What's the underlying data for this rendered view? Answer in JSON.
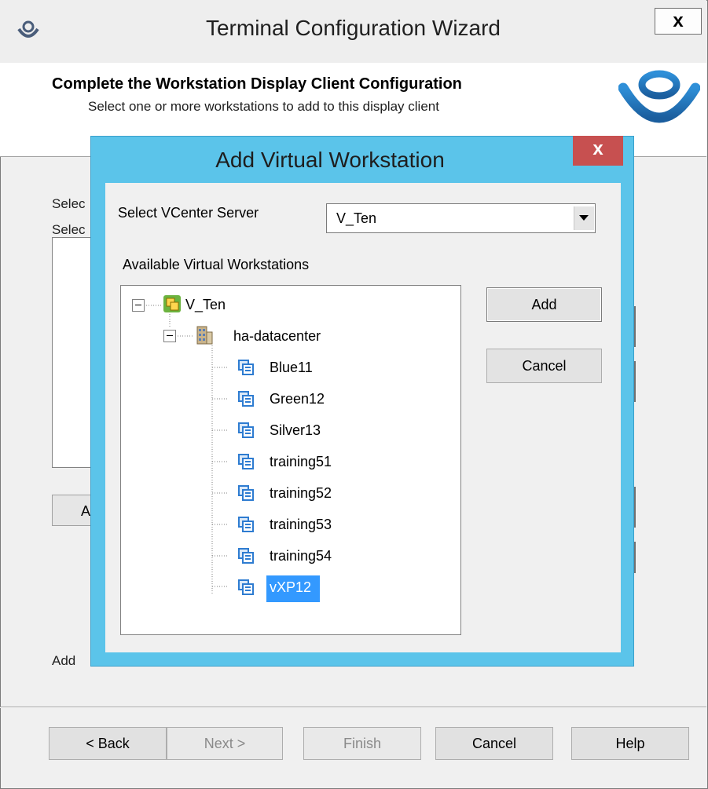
{
  "wizard": {
    "title": "Terminal Configuration Wizard",
    "close_label": "x",
    "header_title": "Complete the Workstation Display Client Configuration",
    "header_subtitle": "Select one or more workstations to add to this display client",
    "body_label_1": "Selec",
    "body_label_2": "Selec",
    "body_button_partial": "A",
    "body_bottom_label": "Add"
  },
  "footer_buttons": {
    "back": "< Back",
    "next": "Next >",
    "finish": "Finish",
    "cancel": "Cancel",
    "help": "Help"
  },
  "dialog": {
    "title": "Add Virtual Workstation",
    "close_label": "x",
    "server_label": "Select VCenter Server",
    "server_value": "V_Ten",
    "available_label": "Available Virtual Workstations",
    "add_button": "Add",
    "cancel_button": "Cancel"
  },
  "tree": {
    "root": "V_Ten",
    "datacenter": "ha-datacenter",
    "vms": [
      "Blue11",
      "Green12",
      "Silver13",
      "training51",
      "training52",
      "training53",
      "training54",
      "vXP12"
    ],
    "selected": "vXP12"
  },
  "colors": {
    "dialog_frame": "#5bc4ea",
    "dialog_close": "#c75050",
    "selection": "#3399ff",
    "vm_icon": "#2e7cd1"
  }
}
